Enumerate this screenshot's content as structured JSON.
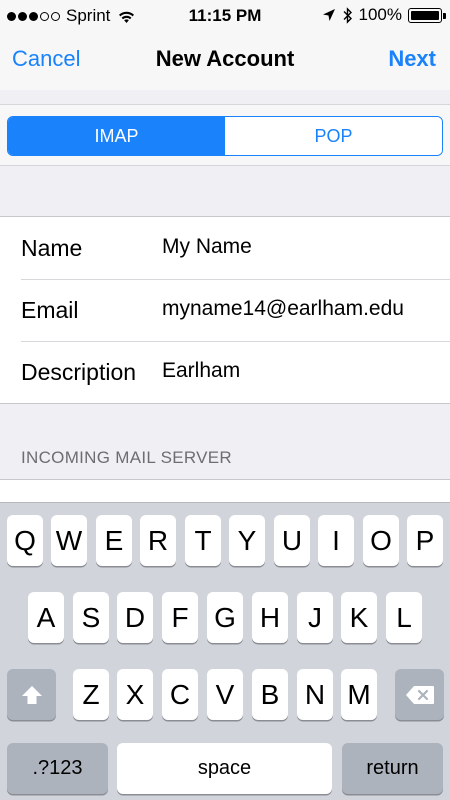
{
  "status": {
    "carrier": "Sprint",
    "time": "11:15 PM",
    "battery": "100%",
    "battery_level": 1.0,
    "signal_bars_filled": 3,
    "signal_bars_total": 5
  },
  "nav": {
    "cancel": "Cancel",
    "title": "New Account",
    "next": "Next"
  },
  "segments": {
    "options": [
      "IMAP",
      "POP"
    ],
    "selected": "IMAP"
  },
  "form": {
    "rows": [
      {
        "label": "Name",
        "value": "My Name"
      },
      {
        "label": "Email",
        "value": "myname14@earlham.edu"
      },
      {
        "label": "Description",
        "value": "Earlham"
      }
    ]
  },
  "section_header": "INCOMING MAIL SERVER",
  "keyboard": {
    "row1": [
      "Q",
      "W",
      "E",
      "R",
      "T",
      "Y",
      "U",
      "I",
      "O",
      "P"
    ],
    "row2": [
      "A",
      "S",
      "D",
      "F",
      "G",
      "H",
      "J",
      "K",
      "L"
    ],
    "row3": [
      "Z",
      "X",
      "C",
      "V",
      "B",
      "N",
      "M"
    ],
    "numbers": ".?123",
    "space": "space",
    "return": "return",
    "shift_icon": "shift-icon",
    "delete_icon": "delete-icon"
  },
  "colors": {
    "accent": "#1a82fb",
    "background": "#efeff4",
    "keyboard": "#d1d5db"
  }
}
